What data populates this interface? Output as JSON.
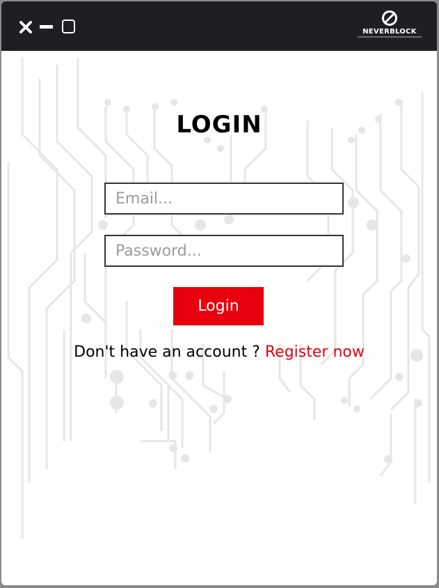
{
  "window": {
    "controls": {
      "close_icon": "close-icon",
      "minimize_icon": "minimize-icon",
      "maximize_icon": "maximize-icon"
    },
    "brand": {
      "logo_icon": "neverblock-logo-icon",
      "name": "NEVERBLOCK"
    }
  },
  "login": {
    "title": "LOGIN",
    "email_placeholder": "Email...",
    "email_value": "",
    "password_placeholder": "Password...",
    "password_value": "",
    "button_label": "Login",
    "register_prompt": "Don't have an account ? ",
    "register_link": "Register now"
  },
  "colors": {
    "titlebar": "#1d1f23",
    "accent": "#e8000f",
    "circuit": "#e4e4e4"
  }
}
